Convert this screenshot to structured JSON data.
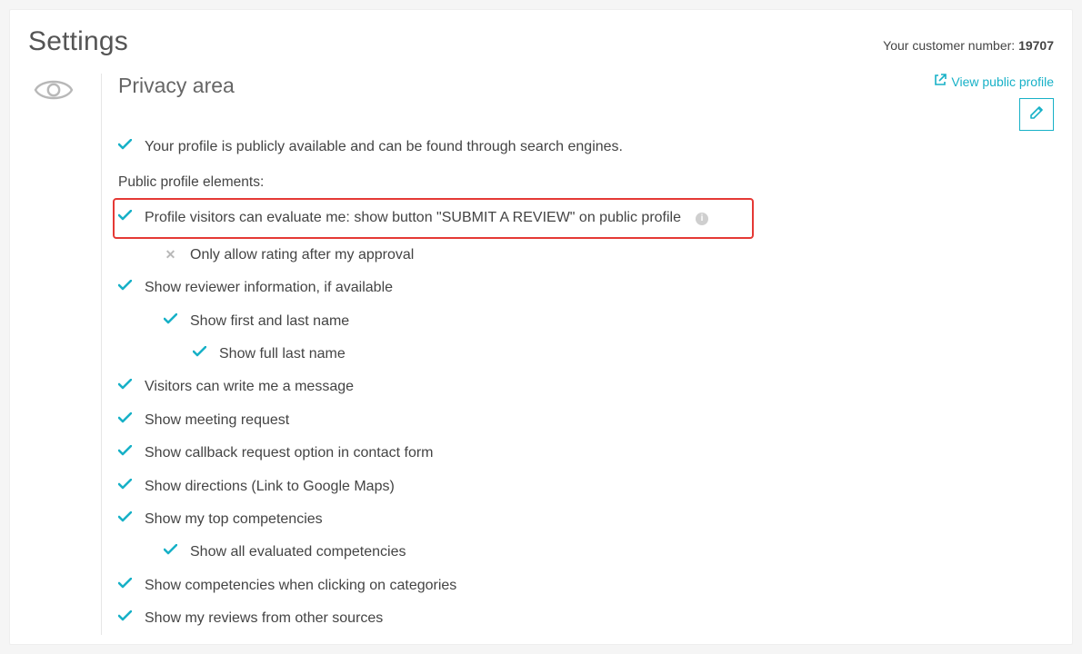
{
  "header": {
    "title": "Settings",
    "customer_label": "Your customer number: ",
    "customer_number": "19707"
  },
  "section": {
    "title": "Privacy area",
    "view_link": "View public profile"
  },
  "row_public": "Your profile is publicly available and can be found through search engines.",
  "elements_label": "Public profile elements:",
  "row_evaluate": "Profile visitors can evaluate me: show button \"SUBMIT A REVIEW\" on public profile",
  "row_approval": "Only allow rating after my approval",
  "row_reviewer_info": "Show reviewer information, if available",
  "row_first_last": "Show first and last name",
  "row_full_last": "Show full last name",
  "row_message": "Visitors can write me a message",
  "row_meeting": "Show meeting request",
  "row_callback": "Show callback request option in contact form",
  "row_directions": "Show directions (Link to Google Maps)",
  "row_top_comp": "Show my top competencies",
  "row_all_eval": "Show all evaluated competencies",
  "row_cat_comp": "Show competencies when clicking on categories",
  "row_other_reviews": "Show my reviews from other sources"
}
